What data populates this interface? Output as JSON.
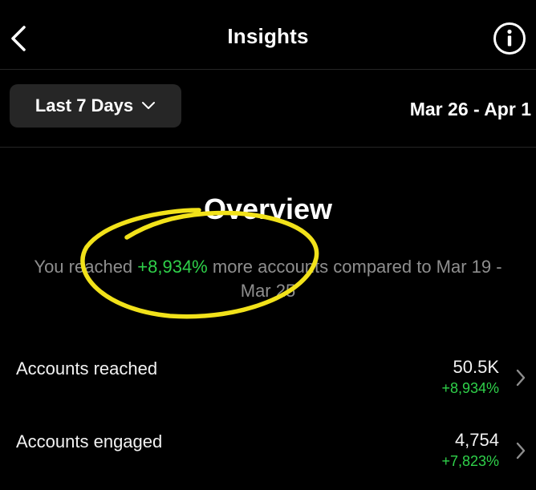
{
  "header": {
    "title": "Insights",
    "back_icon": "chevron-left-icon",
    "info_icon": "info-circle-icon"
  },
  "filter": {
    "range_label": "Last 7 Days",
    "date_range": "Mar 26 - Apr 1"
  },
  "overview": {
    "title": "Overview",
    "text_before": "You reached ",
    "highlight": "+8,934%",
    "text_after": " more accounts compared to Mar 19 - Mar 25"
  },
  "metrics": [
    {
      "label": "Accounts reached",
      "value": "50.5K",
      "change": "+8,934%"
    },
    {
      "label": "Accounts engaged",
      "value": "4,754",
      "change": "+7,823%"
    }
  ],
  "colors": {
    "background": "#000000",
    "positive": "#2fd14a",
    "muted_text": "#8e8e8e",
    "annotation": "#f2e21a",
    "button_bg": "#262626"
  }
}
